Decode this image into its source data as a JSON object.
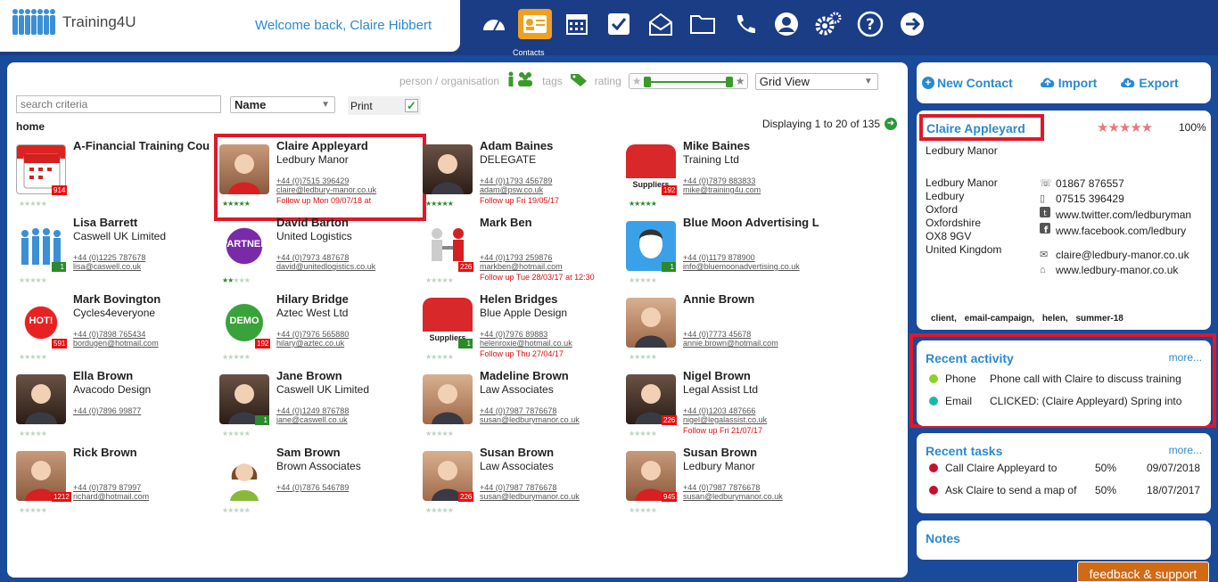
{
  "app": {
    "name": "Training4U",
    "welcome": "Welcome back, Claire Hibbert"
  },
  "topnav": {
    "icons": [
      "dashboard-icon",
      "contacts-icon",
      "calendar-icon",
      "tasks-icon",
      "email-icon",
      "folder-icon",
      "phone-icon",
      "user-icon",
      "settings-icon",
      "help-icon",
      "logout-icon"
    ],
    "active_label": "Contacts"
  },
  "filters": {
    "person_org": "person / organisation",
    "tags": "tags",
    "rating": "rating",
    "view": "Grid View",
    "search_placeholder": "search criteria",
    "sort": "Name",
    "print": "Print",
    "print_checked": "✓",
    "breadcrumb": "home",
    "displaying": "Displaying 1 to 20 of 135"
  },
  "contacts": [
    {
      "name": "A-Financial Training Cou",
      "org": "",
      "phone": "",
      "email": "",
      "follow": "",
      "badge": "914",
      "stars": 0,
      "thumb": "cal"
    },
    {
      "name": "Claire Appleyard",
      "org": "Ledbury Manor",
      "phone": "+44 (0)7515 396429",
      "email": "claire@ledbury-manor.co.uk",
      "follow": "Follow up Mon 09/07/18 at",
      "badge": "",
      "stars": 5,
      "thumb": "face"
    },
    {
      "name": "Adam Baines",
      "org": "DELEGATE",
      "phone": "+44 (0)1793 456789",
      "email": "adam@psw.co.uk",
      "follow": "Follow up Fri 19/05/17",
      "badge": "",
      "stars": 5,
      "thumb": "face2"
    },
    {
      "name": "Mike Baines",
      "org": "Training Ltd",
      "phone": "+44 (0)7879 883833",
      "email": "mike@training4u.com",
      "follow": "",
      "badge": "192",
      "stars": 5,
      "thumb": "supplier",
      "thumb_text": "Suppliers"
    },
    {
      "name": "Lisa Barrett",
      "org": "Caswell UK Limited",
      "phone": "+44 (0)1225 787678",
      "email": "lisa@caswell.co.uk",
      "follow": "",
      "badge": "1",
      "badge_green": true,
      "stars": 0,
      "thumb": "people"
    },
    {
      "name": "David Barton",
      "org": "United Logistics",
      "phone": "+44 (0)7973 487678",
      "email": "david@unitedlogistics.co.uk",
      "follow": "",
      "badge": "",
      "stars": 2,
      "thumb": "partner",
      "thumb_text": "PARTNER"
    },
    {
      "name": "Mark Ben",
      "org": "",
      "phone": "+44 (0)1793 259876",
      "email": "markben@hotmail.com",
      "follow": "Follow up Tue 28/03/17 at 12:30",
      "badge": "226",
      "stars": 0,
      "thumb": "shake"
    },
    {
      "name": "Blue Moon Advertising L",
      "org": "",
      "phone": "+44 (0)1179 878900",
      "email": "info@bluemoonadvertising.co.uk",
      "follow": "",
      "badge": "1",
      "badge_green": true,
      "stars": 0,
      "thumb": "blueface"
    },
    {
      "name": "Mark Bovington",
      "org": "Cycles4everyone",
      "phone": "+44 (0)7898 765434",
      "email": "bordugen@hotmail.com",
      "follow": "",
      "badge": "591",
      "stars": 0,
      "thumb": "hot",
      "thumb_text": "HOT!"
    },
    {
      "name": "Hilary Bridge",
      "org": "Aztec West Ltd",
      "phone": "+44 (0)7976 565880",
      "email": "hilary@aztec.co.uk",
      "follow": "",
      "badge": "192",
      "stars": 0,
      "thumb": "demo",
      "thumb_text": "DEMO"
    },
    {
      "name": "Helen Bridges",
      "org": "Blue Apple Design",
      "phone": "+44 (0)7976 89883",
      "email": "helenroxie@hotmail.co.uk",
      "follow": "Follow up Thu 27/04/17",
      "badge": "1",
      "badge_green": true,
      "stars": 0,
      "thumb": "supplier",
      "thumb_text": "Suppliers"
    },
    {
      "name": "Annie Brown",
      "org": "",
      "phone": "+44 (0)7773 45678",
      "email": "annie.brown@hotmail.com",
      "follow": "",
      "badge": "",
      "stars": 0,
      "thumb": "face3"
    },
    {
      "name": "Ella Brown",
      "org": "Avacodo Design",
      "phone": "+44 (0)7896 99877",
      "email": "",
      "follow": "",
      "badge": "",
      "stars": 0,
      "thumb": "face2"
    },
    {
      "name": "Jane Brown",
      "org": "Caswell UK Limited",
      "phone": "+44 (0)1249 876788",
      "email": "jane@caswell.co.uk",
      "follow": "",
      "badge": "1",
      "badge_green": true,
      "stars": 0,
      "thumb": "face2"
    },
    {
      "name": "Madeline Brown",
      "org": "Law Associates",
      "phone": "+44 (0)7987 7876678",
      "email": "susan@ledburymanor.co.uk",
      "follow": "",
      "badge": "",
      "stars": 0,
      "thumb": "face3"
    },
    {
      "name": "Nigel Brown",
      "org": "Legal Assist Ltd",
      "phone": "+44 (0)1203 487666",
      "email": "nigel@legalassist.co.uk",
      "follow": "Follow up Fri 21/07/17",
      "badge": "226",
      "stars": 0,
      "thumb": "face2"
    },
    {
      "name": "Rick Brown",
      "org": "",
      "phone": "+44 (0)7879 87997",
      "email": "richard@hotmail.com",
      "follow": "",
      "badge": "1212",
      "stars": 0,
      "thumb": "face"
    },
    {
      "name": "Sam Brown",
      "org": "Brown Associates",
      "phone": "+44 (0)7876 546789",
      "email": "",
      "follow": "",
      "badge": "",
      "stars": 0,
      "thumb": "avatar"
    },
    {
      "name": "Susan Brown",
      "org": "Law Associates",
      "phone": "+44 (0)7987 7876678",
      "email": "susan@ledburymanor.co.uk",
      "follow": "",
      "badge": "226",
      "stars": 0,
      "thumb": "face3"
    },
    {
      "name": "Susan Brown",
      "org": "Ledbury Manor",
      "phone": "+44 (0)7987 7876678",
      "email": "susan@ledburymanor.co.uk",
      "follow": "",
      "badge": "945",
      "stars": 0,
      "thumb": "face"
    }
  ],
  "actions": {
    "new_contact": "New Contact",
    "import": "Import",
    "export": "Export"
  },
  "detail": {
    "name": "Claire Appleyard",
    "stars": "★★★★★",
    "percent": "100%",
    "org": "Ledbury Manor",
    "address": [
      "Ledbury Manor",
      "Ledbury",
      "Oxford",
      "Oxfordshire",
      "OX8 9GV",
      "United Kingdom"
    ],
    "landline": "01867 876557",
    "mobile": "07515 396429",
    "twitter": "www.twitter.com/ledburyman",
    "facebook": "www.facebook.com/ledbury",
    "email": "claire@ledbury-manor.co.uk",
    "web": "www.ledbury-manor.co.uk",
    "tags": "client, email-campaign, helen, summer-18"
  },
  "activity": {
    "title": "Recent activity",
    "more": "more...",
    "rows": [
      {
        "type": "Phone",
        "text": "Phone call with Claire to discuss training",
        "color": "#8cd22a"
      },
      {
        "type": "Email",
        "text": "CLICKED: (Claire Appleyard) Spring into",
        "color": "#1ab8a8"
      }
    ]
  },
  "tasks": {
    "title": "Recent tasks",
    "more": "more...",
    "rows": [
      {
        "text": "Call Claire Appleyard to",
        "pct": "50%",
        "date": "09/07/2018"
      },
      {
        "text": "Ask Claire to send a map of",
        "pct": "50%",
        "date": "18/07/2017"
      }
    ]
  },
  "notes": {
    "title": "Notes"
  },
  "feedback": "feedback & support",
  "colors": {
    "accent": "#2a8ad0",
    "nav_bg": "#1a3d85",
    "highlight": "#e01828",
    "badge": "#e81010"
  }
}
